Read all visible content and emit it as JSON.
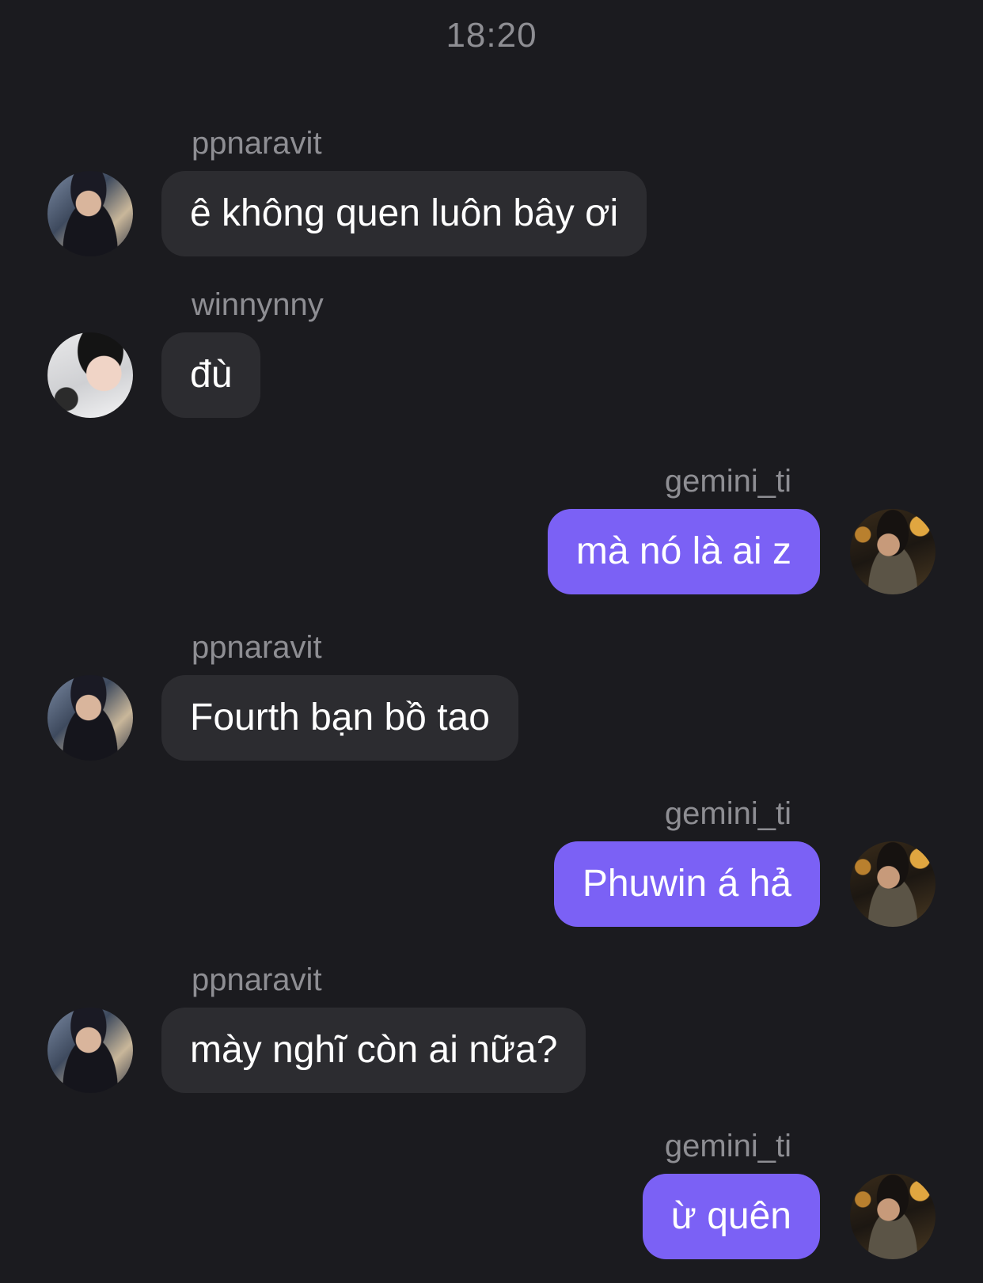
{
  "header": {
    "timestamp": "18:20"
  },
  "colors": {
    "background": "#1b1b1f",
    "incoming_bubble": "#2c2c30",
    "outgoing_bubble": "#7b61f5",
    "meta_text": "#8e8e93"
  },
  "messages": [
    {
      "direction": "incoming",
      "sender": "ppnaravit",
      "text": "ê không quen luôn bây ơi",
      "avatar": "ppnaravit-avatar"
    },
    {
      "direction": "incoming",
      "sender": "winnynny",
      "text": "đù",
      "avatar": "winnynny-avatar"
    },
    {
      "direction": "outgoing",
      "sender": "gemini_ti",
      "text": "mà nó là ai z",
      "avatar": "gemini_ti-avatar"
    },
    {
      "direction": "incoming",
      "sender": "ppnaravit",
      "text": "Fourth bạn bồ tao",
      "avatar": "ppnaravit-avatar"
    },
    {
      "direction": "outgoing",
      "sender": "gemini_ti",
      "text": "Phuwin á hả",
      "avatar": "gemini_ti-avatar"
    },
    {
      "direction": "incoming",
      "sender": "ppnaravit",
      "text": "mày nghĩ còn ai nữa?",
      "avatar": "ppnaravit-avatar"
    },
    {
      "direction": "outgoing",
      "sender": "gemini_ti",
      "text": "ừ quên",
      "avatar": "gemini_ti-avatar"
    }
  ]
}
